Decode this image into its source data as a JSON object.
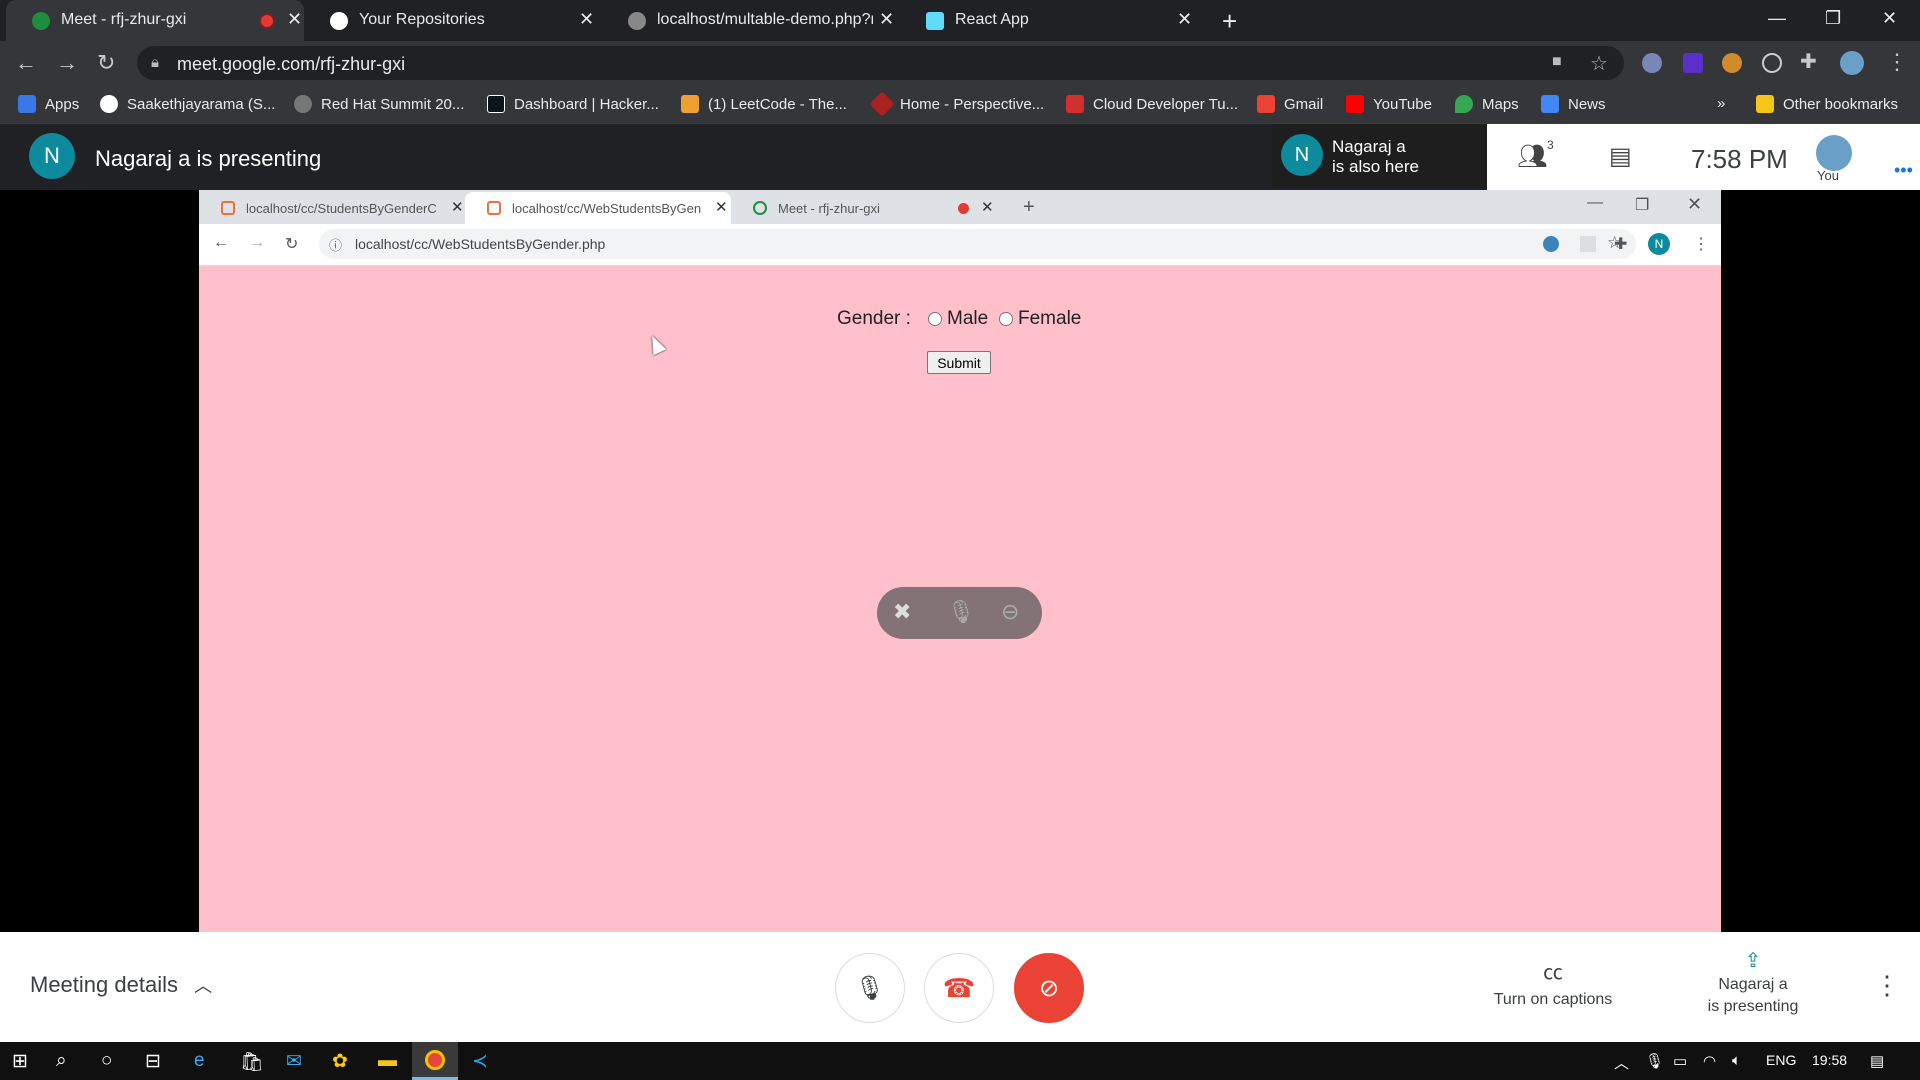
{
  "browser": {
    "tabs": [
      {
        "label": "Meet - rfj-zhur-gxi",
        "recording": true
      },
      {
        "label": "Your Repositories"
      },
      {
        "label": "localhost/multable-demo.php?nu"
      },
      {
        "label": "React App"
      }
    ],
    "url": "meet.google.com/rfj-zhur-gxi",
    "bookmarks": [
      {
        "label": "Apps"
      },
      {
        "label": "Saakethjayarama (S..."
      },
      {
        "label": "Red Hat Summit 20..."
      },
      {
        "label": "Dashboard | Hacker..."
      },
      {
        "label": "(1) LeetCode - The..."
      },
      {
        "label": "Home - Perspective..."
      },
      {
        "label": "Cloud Developer Tu..."
      },
      {
        "label": "Gmail"
      },
      {
        "label": "YouTube"
      },
      {
        "label": "Maps"
      },
      {
        "label": "News"
      }
    ],
    "bookmarks_overflow": "»",
    "other_bookmarks": "Other bookmarks"
  },
  "meet": {
    "presenter_initial": "N",
    "presenting_title": "Nagaraj a is presenting",
    "also_here_line1": "Nagaraj a",
    "also_here_line2": "is also here",
    "participant_count": "3",
    "time": "7:58 PM",
    "you_label": "You",
    "meeting_details": "Meeting details",
    "captions_label": "Turn on captions",
    "present_line1": "Nagaraj a",
    "present_line2": "is presenting"
  },
  "shared_screen": {
    "tabs": [
      {
        "label": "localhost/cc/StudentsByGenderC"
      },
      {
        "label": "localhost/cc/WebStudentsByGen"
      },
      {
        "label": "Meet - rfj-zhur-gxi"
      }
    ],
    "profile_initial": "N",
    "url": "localhost/cc/WebStudentsByGender.php",
    "form": {
      "gender_label": "Gender :",
      "option_male": "Male",
      "option_female": "Female",
      "submit": "Submit"
    }
  },
  "taskbar": {
    "language": "ENG",
    "time": "19:58"
  },
  "colors": {
    "page_bg": "#ffc0cb",
    "meet_teal": "#0d8a9c",
    "hangup_red": "#ea4335"
  }
}
